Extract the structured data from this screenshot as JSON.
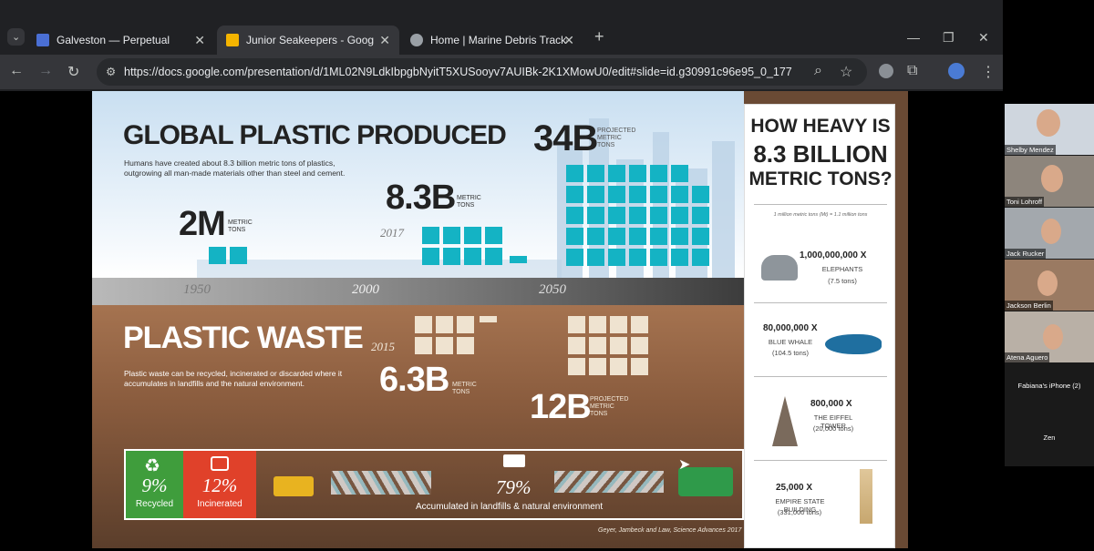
{
  "browser": {
    "tabs": [
      {
        "title": "Galveston — Perpetual",
        "favicon_color": "#4a6fd4",
        "active": false
      },
      {
        "title": "Junior Seakeepers - Google Slides",
        "favicon_color": "#f4b400",
        "active": true
      },
      {
        "title": "Home | Marine Debris Tracker",
        "favicon_color": "#9aa0a6",
        "active": false
      }
    ],
    "new_tab": "+",
    "url": "https://docs.google.com/presentation/d/1ML02N9LdkIbpgbNyitT5XUSooyv7AUIBk-2K1XMowU0/edit#slide=id.g30991c96e95_0_177"
  },
  "slide": {
    "title_produced": "GLOBAL PLASTIC PRODUCED",
    "desc_produced": "Humans have created about 8.3 billion metric tons of plastics, outgrowing all man-made materials other than steel and cement.",
    "stat_2m": "2M",
    "unit_metric_tons": "METRIC TONS",
    "stat_83b": "8.3B",
    "year_2017": "2017",
    "stat_34b": "34B",
    "unit_projected": "PROJECTED METRIC TONS",
    "years": [
      "1950",
      "2000",
      "2050"
    ],
    "title_waste": "PLASTIC WASTE",
    "desc_waste": "Plastic waste can be recycled, incinerated or discarded where it accumulates in landfills and the natural environment.",
    "year_2015": "2015",
    "stat_63b": "6.3B",
    "stat_12b": "12B",
    "recycled_pct": "9%",
    "recycled_label": "Recycled",
    "incinerated_pct": "12%",
    "incinerated_label": "Incinerated",
    "accum_pct": "79%",
    "accum_label": "Accumulated in landfills & natural environment",
    "source": "Geyer, Jambeck and Law, Science Advances 2017",
    "panel": {
      "heading": [
        "HOW HEAVY IS",
        "8.3 BILLION",
        "METRIC TONS?"
      ],
      "footnote": "1 million metric tons (Mt) = 1.1 million tons",
      "rows": [
        {
          "count": "1,000,000,000 X",
          "label": "ELEPHANTS",
          "sub": "(7.5 tons)"
        },
        {
          "count": "80,000,000 X",
          "label": "BLUE WHALE",
          "sub": "(104.5 tons)"
        },
        {
          "count": "800,000 X",
          "label": "THE EIFFEL TOWER",
          "sub": "(20,000 tons)"
        },
        {
          "count": "25,000 X",
          "label": "EMPIRE STATE BUILDING",
          "sub": "(331,000 tons)"
        }
      ]
    }
  },
  "participants": [
    "Shelby Mendez",
    "Toni Lohroff",
    "Jack Rucker",
    "Jackson Berlin",
    "Atena Aguero",
    "Fabiana's iPhone (2)",
    "Zen"
  ]
}
